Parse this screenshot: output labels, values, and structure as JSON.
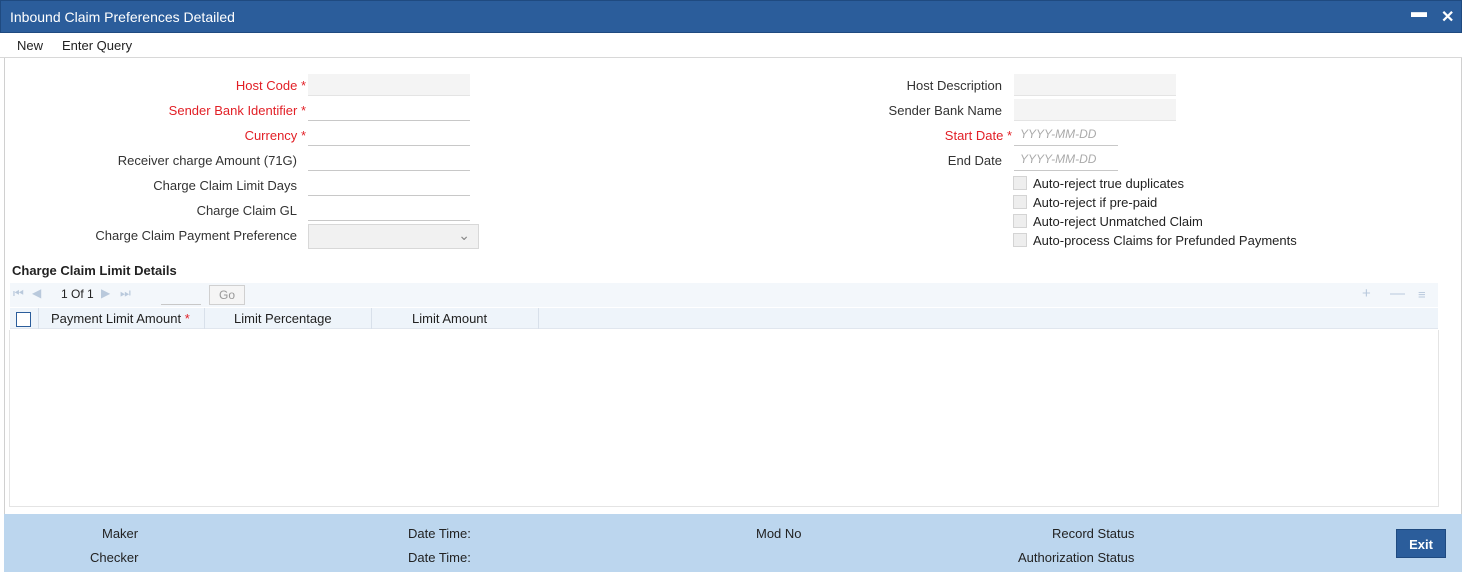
{
  "window": {
    "title": "Inbound Claim Preferences Detailed",
    "minimize_glyph": "▬",
    "close_glyph": "✕"
  },
  "menu": {
    "new": "New",
    "enter_query": "Enter Query"
  },
  "form": {
    "host_code_label": "Host Code",
    "sender_bank_identifier_label": "Sender Bank Identifier",
    "currency_label": "Currency",
    "receiver_charge_amount_label": "Receiver charge Amount (71G)",
    "charge_claim_limit_days_label": "Charge Claim Limit Days",
    "charge_claim_gl_label": "Charge Claim GL",
    "charge_claim_payment_preference_label": "Charge Claim Payment Preference",
    "host_description_label": "Host Description",
    "sender_bank_name_label": "Sender Bank Name",
    "start_date_label": "Start Date",
    "end_date_label": "End Date",
    "date_placeholder": "YYYY-MM-DD",
    "required_mark": "*"
  },
  "checkboxes": [
    {
      "label": "Auto-reject true duplicates"
    },
    {
      "label": "Auto-reject if pre-paid"
    },
    {
      "label": "Auto-reject Unmatched Claim"
    },
    {
      "label": "Auto-process Claims for Prefunded Payments"
    }
  ],
  "limit_details": {
    "section_title": "Charge Claim Limit Details",
    "page_current": "1",
    "page_of": "Of",
    "page_total": "1",
    "go_label": "Go",
    "columns": [
      "Payment Limit Amount",
      "Limit Percentage",
      "Limit Amount"
    ]
  },
  "footer": {
    "maker": "Maker",
    "checker": "Checker",
    "date_time_1": "Date Time:",
    "date_time_2": "Date Time:",
    "mod_no": "Mod No",
    "record_status": "Record Status",
    "authorization_status": "Authorization Status",
    "exit": "Exit"
  },
  "colors": {
    "titlebar": "#2b5d9b",
    "required": "#e21f26",
    "footer": "#bcd6ee"
  }
}
